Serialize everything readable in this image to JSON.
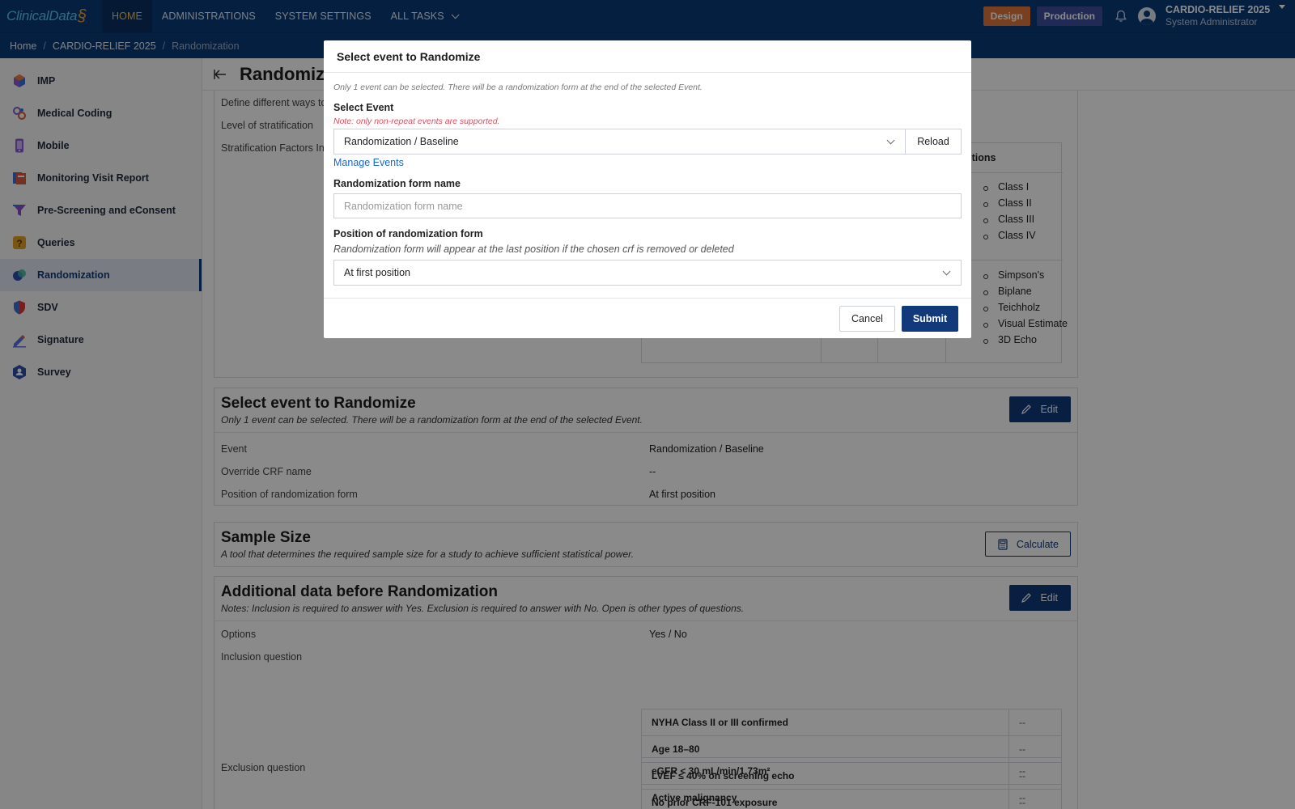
{
  "app": {
    "logo_text": "ClinicalData",
    "logo_mark": "§"
  },
  "nav": {
    "items": [
      "HOME",
      "ADMINISTRATIONS",
      "SYSTEM SETTINGS",
      "ALL TASKS"
    ]
  },
  "env": {
    "design": "Design",
    "production": "Production"
  },
  "user": {
    "study": "CARDIO-RELIEF 2025",
    "role": "System Administrator"
  },
  "breadcrumb": [
    "Home",
    "CARDIO-RELIEF 2025",
    "Randomization"
  ],
  "sidebar": {
    "items": [
      {
        "label": "IMP",
        "icon": "cube-icon",
        "color": "#3b6fd6"
      },
      {
        "label": "Medical Coding",
        "icon": "coding-icon",
        "color": "#7a5bd0"
      },
      {
        "label": "Mobile",
        "icon": "mobile-icon",
        "color": "#8a5ad6"
      },
      {
        "label": "Monitoring Visit Report",
        "icon": "report-icon",
        "color": "#d65a3b"
      },
      {
        "label": "Pre-Screening and eConsent",
        "icon": "funnel-icon",
        "color": "#8a4fc9"
      },
      {
        "label": "Queries",
        "icon": "question-icon",
        "color": "#e0a020"
      },
      {
        "label": "Randomization",
        "icon": "randomization-icon",
        "color": "#2b4fa8"
      },
      {
        "label": "SDV",
        "icon": "shield-icon",
        "color": "#d63b3b"
      },
      {
        "label": "Signature",
        "icon": "pen-icon",
        "color": "#5b6fd6"
      },
      {
        "label": "Survey",
        "icon": "survey-icon",
        "color": "#2b4fa8"
      }
    ]
  },
  "page": {
    "title": "Randomiz",
    "strat_rows": [
      "Define different ways to",
      "Level of stratification",
      "Stratification Factors Inf"
    ],
    "options_header": "ptions",
    "options_a": [
      "Class I",
      "Class II",
      "Class III",
      "Class IV"
    ],
    "options_b": [
      "Simpson's",
      "Biplane",
      "Teichholz",
      "Visual Estimate",
      "3D Echo"
    ]
  },
  "event_card": {
    "title": "Select event to Randomize",
    "subtitle": "Only 1 event can be selected. There will be a randomization form at the end of the selected Event.",
    "edit_label": "Edit",
    "rows": [
      {
        "k": "Event",
        "v": "Randomization / Baseline"
      },
      {
        "k": "Override CRF name",
        "v": "--"
      },
      {
        "k": "Position of randomization form",
        "v": "At first position"
      }
    ]
  },
  "sample_card": {
    "title": "Sample Size",
    "subtitle": "A tool that determines the required sample size for a study to achieve sufficient statistical power.",
    "calc_label": "Calculate"
  },
  "additional_card": {
    "title": "Additional data before Randomization",
    "subtitle": "Notes: Inclusion is required to answer with Yes. Exclusion is required to answer with No. Open is other types of questions.",
    "edit_label": "Edit",
    "options_label": "Options",
    "options_value": "Yes / No",
    "inclusion_label": "Inclusion question",
    "inclusion": [
      {
        "q": "NYHA Class II or III confirmed",
        "a": "--"
      },
      {
        "q": "Age 18–80",
        "a": "--"
      },
      {
        "q": "LVEF ≤ 40% on screening echo",
        "a": "--"
      },
      {
        "q": "No prior CRF-101 exposure",
        "a": "--"
      }
    ],
    "exclusion_label": "Exclusion question",
    "exclusion": [
      {
        "q": "eGFR < 30 mL/min/1.73m²",
        "a": "--"
      },
      {
        "q": "Active malignancy",
        "a": "--"
      }
    ]
  },
  "modal": {
    "title": "Select event to Randomize",
    "hint": "Only 1 event can be selected. There will be a randomization form at the end of the selected Event.",
    "select_event_label": "Select Event",
    "note": "Note: only non-repeat events are supported.",
    "event_value": "Randomization / Baseline",
    "reload_label": "Reload",
    "manage_link": "Manage Events",
    "form_name_label": "Randomization form name",
    "form_name_placeholder": "Randomization form name",
    "position_label": "Position of randomization form",
    "position_desc": "Randomization form will appear at the last position if the chosen crf is removed or deleted",
    "position_value": "At first position",
    "cancel_label": "Cancel",
    "submit_label": "Submit"
  }
}
